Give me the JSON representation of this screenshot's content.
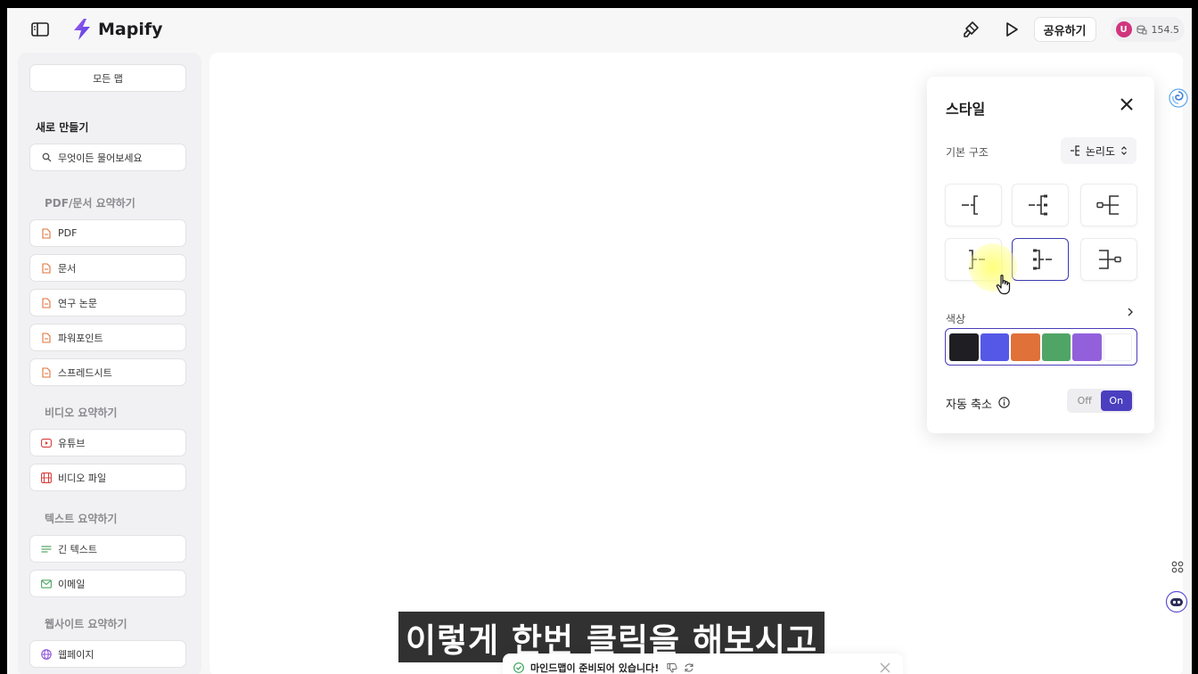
{
  "app": {
    "name": "Mapify"
  },
  "toolbar": {
    "share_label": "공유하기",
    "avatar_initial": "U",
    "credits": "154.5"
  },
  "sidebar": {
    "all_maps": "모든 맵",
    "new_heading": "새로 만들기",
    "search_placeholder": "무엇이든 물어보세요",
    "sections": [
      {
        "title": "PDF/문서 요약하기",
        "items": [
          "PDF",
          "문서",
          "연구 논문",
          "파워포인트",
          "스프레드시트"
        ]
      },
      {
        "title": "비디오 요약하기",
        "items": [
          "유튜브",
          "비디오 파일"
        ]
      },
      {
        "title": "텍스트 요약하기",
        "items": [
          "긴 텍스트",
          "이메일"
        ]
      },
      {
        "title": "웹사이트 요약하기",
        "items": [
          "웹페이지"
        ]
      }
    ]
  },
  "style_panel": {
    "title": "스타일",
    "structure_label": "기본 구조",
    "structure_value": "논리도",
    "layout_options": [
      "logic-left",
      "logic-left-dots",
      "logic-left-box",
      "logic-right",
      "logic-right-dots",
      "logic-right-box"
    ],
    "selected_layout": 4,
    "color_label": "색상",
    "colors": [
      "#1f1f23",
      "#5558e6",
      "#e07138",
      "#4fa565",
      "#9360dc",
      "#ffffff"
    ],
    "auto_collapse_label": "자동 축소",
    "toggle_off": "Off",
    "toggle_on": "On",
    "auto_collapse": "On"
  },
  "subtitle": "이렇게 한번 클릭을 해보시고",
  "toast": {
    "message": "마인드맵이 준비되어 있습니다!"
  }
}
